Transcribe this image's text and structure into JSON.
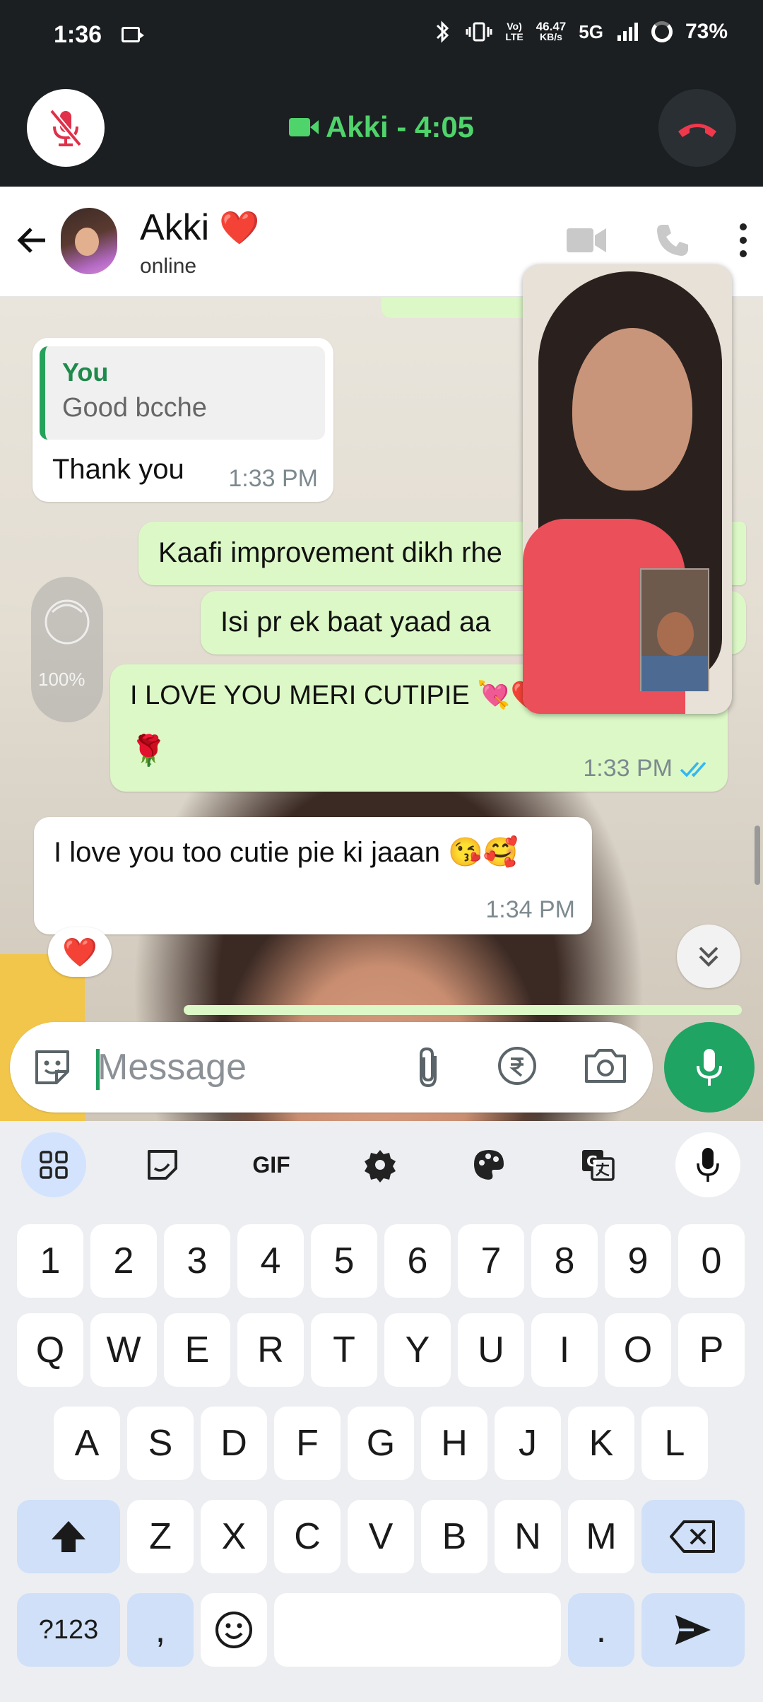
{
  "status_bar": {
    "time": "1:36",
    "network_speed_value": "46.47",
    "network_speed_unit": "KB/s",
    "volte_top": "Vo)",
    "volte_bottom": "LTE",
    "network_type": "5G",
    "battery": "73%"
  },
  "call_bar": {
    "title": "Akki - 4:05"
  },
  "chat_header": {
    "contact_name": "Akki",
    "name_emoji": "❤️",
    "status": "online"
  },
  "messages": [
    {
      "direction": "incoming",
      "quote_author": "You",
      "quote_text": "Good bcche",
      "text": "Thank you",
      "time": "1:33 PM"
    },
    {
      "direction": "outgoing",
      "text": "Kaafi improvement dikh rhe"
    },
    {
      "direction": "outgoing",
      "text": "Isi pr ek baat yaad aa"
    },
    {
      "direction": "outgoing",
      "text": "I LOVE YOU MERI CUTIPIE 💘❤️💕",
      "emoji": "🌹",
      "time": "1:33 PM",
      "read": true
    },
    {
      "direction": "incoming",
      "text": "I love you too cutie pie ki jaaan 😘🥰",
      "time": "1:34 PM",
      "reaction": "❤️"
    }
  ],
  "lock_overlay_percent": "100%",
  "composer": {
    "placeholder": "Message"
  },
  "keyboard": {
    "toolbar_gif": "GIF",
    "rows": [
      [
        "1",
        "2",
        "3",
        "4",
        "5",
        "6",
        "7",
        "8",
        "9",
        "0"
      ],
      [
        "Q",
        "W",
        "E",
        "R",
        "T",
        "Y",
        "U",
        "I",
        "O",
        "P"
      ],
      [
        "A",
        "S",
        "D",
        "F",
        "G",
        "H",
        "J",
        "K",
        "L"
      ],
      [
        "Z",
        "X",
        "C",
        "V",
        "B",
        "N",
        "M"
      ]
    ],
    "symbols_key": "?123",
    "comma_key": ",",
    "period_key": ".",
    "emoji_key": "☺"
  },
  "colors": {
    "accent_green": "#1fa463",
    "call_green": "#4fd46b",
    "outgoing_bubble": "#dcf8c6",
    "read_ticks": "#34b7f1",
    "end_call_red": "#f0384c"
  }
}
